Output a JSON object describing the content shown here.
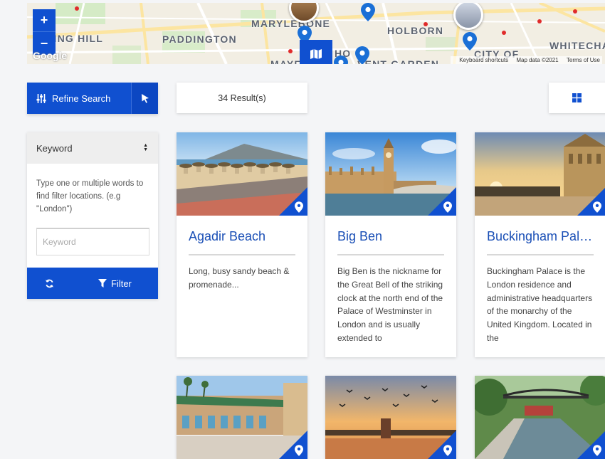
{
  "map": {
    "labels": [
      "TTING HILL",
      "PADDINGTON",
      "MARYLEBONE",
      "HOLBORN",
      "WHITECHA",
      "CITY OF",
      "MAYF",
      "HO",
      "VENT GARDEN"
    ],
    "zoom_in": "+",
    "zoom_out": "−",
    "google": "Google",
    "attribution": {
      "shortcuts": "Keyboard shortcuts",
      "data": "Map data ©2021",
      "terms": "Terms of Use"
    }
  },
  "sidebar": {
    "refine_label": "Refine Search",
    "keyword_header": "Keyword",
    "help_text": "Type one or multiple words to find filter locations. (e.g \"London\")",
    "keyword_placeholder": "Keyword",
    "filter_label": "Filter"
  },
  "results": {
    "count_label": "34 Result(s)"
  },
  "cards": [
    {
      "title": "Agadir Beach",
      "description": "Long, busy sandy beach & promenade..."
    },
    {
      "title": "Big Ben",
      "description": "Big Ben is the nickname for the Great Bell of the striking clock at the north end of the Palace of Westminster in London and is usually extended to"
    },
    {
      "title": "Buckingham Palace",
      "description": "Buckingham Palace is the London residence and administrative headquarters of the monarchy of the United Kingdom. Located in the"
    },
    {
      "title": "",
      "description": ""
    },
    {
      "title": "",
      "description": ""
    },
    {
      "title": "",
      "description": ""
    }
  ],
  "colors": {
    "primary": "#1050d0",
    "title_blue": "#1a4fb6",
    "background": "#f4f5f7"
  },
  "icons": [
    "plus-icon",
    "minus-icon",
    "map-icon",
    "sliders-icon",
    "pointer-icon",
    "sort-icon",
    "reset-icon",
    "funnel-icon",
    "grid-icon",
    "location-pin-icon"
  ]
}
